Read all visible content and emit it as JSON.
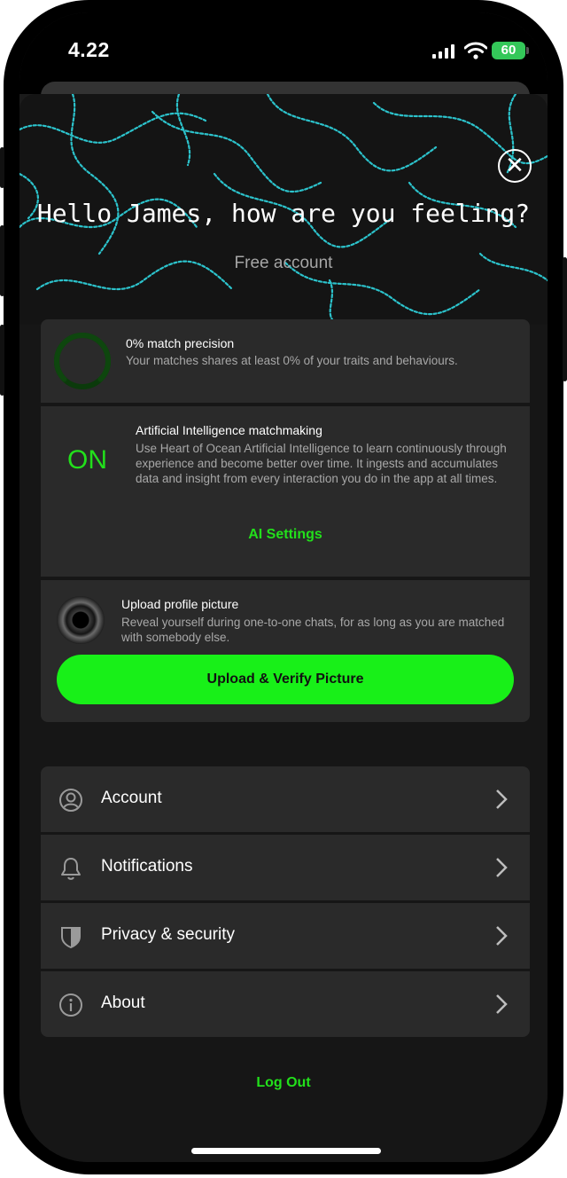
{
  "status_bar": {
    "time": "4.22",
    "battery": "60"
  },
  "header": {
    "greeting": "Hello James, how are you feeling?",
    "account_type": "Free account"
  },
  "match": {
    "title": "0% match precision",
    "description": "Your matches shares at least 0% of your traits and behaviours.",
    "precision": 0
  },
  "ai": {
    "status": "ON",
    "title": "Artificial Intelligence matchmaking",
    "description": "Use Heart of Ocean Artificial Intelligence to learn continuously through experience and become better over time. It ingests and accumulates data and insight from every interaction you do in the app at all times.",
    "settings_label": "AI Settings"
  },
  "upload": {
    "title": "Upload profile picture",
    "description": "Reveal yourself during one-to-one chats, for as long as you are matched with somebody else.",
    "button_label": "Upload & Verify Picture"
  },
  "menu": [
    {
      "label": "Account",
      "icon": "user-circle-icon"
    },
    {
      "label": "Notifications",
      "icon": "bell-icon"
    },
    {
      "label": "Privacy & security",
      "icon": "shield-icon"
    },
    {
      "label": "About",
      "icon": "info-icon"
    }
  ],
  "logout_label": "Log Out",
  "colors": {
    "accent": "#22e01b",
    "button": "#18f018",
    "card": "#2a2a2a",
    "background": "#161616"
  }
}
